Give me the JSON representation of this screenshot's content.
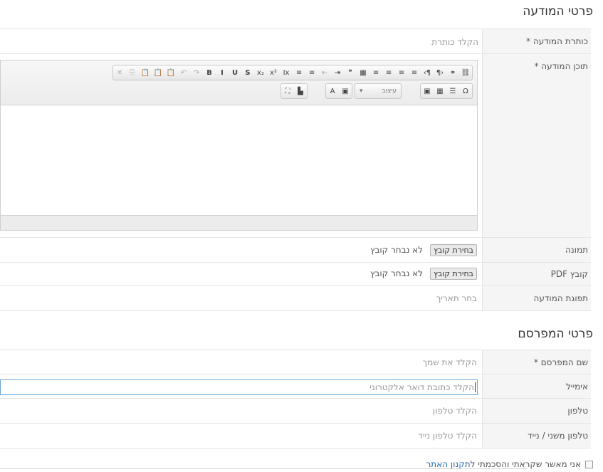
{
  "sections": {
    "ad_details": "פרטי המודעה",
    "publisher_details": "פרטי המפרסם"
  },
  "fields": {
    "title": {
      "label": "כותרת המודעה *",
      "placeholder": "הקלד כותרת"
    },
    "content": {
      "label": "תוכן המודעה *"
    },
    "image": {
      "label": "תמונה",
      "button": "בחירת קובץ",
      "status": "לא נבחר קובץ"
    },
    "pdf": {
      "label": "קובץ PDF",
      "button": "בחירת קובץ",
      "status": "לא נבחר קובץ"
    },
    "expiry": {
      "label": "תפוגת המודעה",
      "placeholder": "בחר תאריך"
    },
    "name": {
      "label": "שם המפרסם *",
      "placeholder": "הקלד את שמך"
    },
    "email": {
      "label": "אימייל",
      "placeholder": "הקלד כתובת דואר אלקטרוני"
    },
    "phone": {
      "label": "טלפון",
      "placeholder": "הקלד טלפון"
    },
    "mobile": {
      "label": "טלפון משני / נייד",
      "placeholder": "הקלד טלפון נייד"
    }
  },
  "editor": {
    "format_select": "עיצוב",
    "toolbar_row1": [
      {
        "name": "cut-icon",
        "glyph": "✕",
        "dim": true
      },
      {
        "name": "copy-icon",
        "glyph": "⎘",
        "dim": true
      },
      {
        "name": "paste-icon",
        "glyph": "📋"
      },
      {
        "name": "paste-text-icon",
        "glyph": "📋"
      },
      {
        "name": "paste-word-icon",
        "glyph": "📋"
      },
      {
        "name": "undo-icon",
        "glyph": "↶",
        "dim": true
      },
      {
        "name": "redo-icon",
        "glyph": "↷",
        "dim": true
      },
      {
        "name": "bold-icon",
        "glyph": "B"
      },
      {
        "name": "italic-icon",
        "glyph": "I"
      },
      {
        "name": "underline-icon",
        "glyph": "U"
      },
      {
        "name": "strike-icon",
        "glyph": "S"
      },
      {
        "name": "subscript-icon",
        "glyph": "x₂"
      },
      {
        "name": "superscript-icon",
        "glyph": "x²"
      },
      {
        "name": "remove-format-icon",
        "glyph": "Ix"
      },
      {
        "name": "numbered-list-icon",
        "glyph": "≡"
      },
      {
        "name": "bulleted-list-icon",
        "glyph": "≡"
      },
      {
        "name": "outdent-icon",
        "glyph": "⇤",
        "dim": true
      },
      {
        "name": "indent-icon",
        "glyph": "⇥"
      },
      {
        "name": "blockquote-icon",
        "glyph": "❞"
      },
      {
        "name": "div-icon",
        "glyph": "▦"
      },
      {
        "name": "align-left-icon",
        "glyph": "≡"
      },
      {
        "name": "align-center-icon",
        "glyph": "≡"
      },
      {
        "name": "align-right-icon",
        "glyph": "≡"
      },
      {
        "name": "justify-icon",
        "glyph": "≡"
      },
      {
        "name": "ltr-icon",
        "glyph": "¶›"
      },
      {
        "name": "rtl-icon",
        "glyph": "‹¶"
      },
      {
        "name": "link-icon",
        "glyph": "⚭"
      },
      {
        "name": "unlink-icon",
        "glyph": "⛓"
      }
    ],
    "toolbar_row2": [
      {
        "name": "image-icon",
        "glyph": "▣"
      },
      {
        "name": "table-icon",
        "glyph": "▦"
      },
      {
        "name": "horizontal-line-icon",
        "glyph": "☰"
      },
      {
        "name": "special-char-icon",
        "glyph": "Ω"
      }
    ],
    "toolbar_row2b": [
      {
        "name": "text-color-icon",
        "glyph": "A"
      },
      {
        "name": "bg-color-icon",
        "glyph": "▣"
      }
    ],
    "toolbar_row2c": [
      {
        "name": "maximize-icon",
        "glyph": "⛶"
      },
      {
        "name": "show-blocks-icon",
        "glyph": "▙"
      }
    ]
  },
  "consent": {
    "text": "אני מאשר שקראתי והסכמתי ל",
    "link": "תקנון האתר"
  }
}
